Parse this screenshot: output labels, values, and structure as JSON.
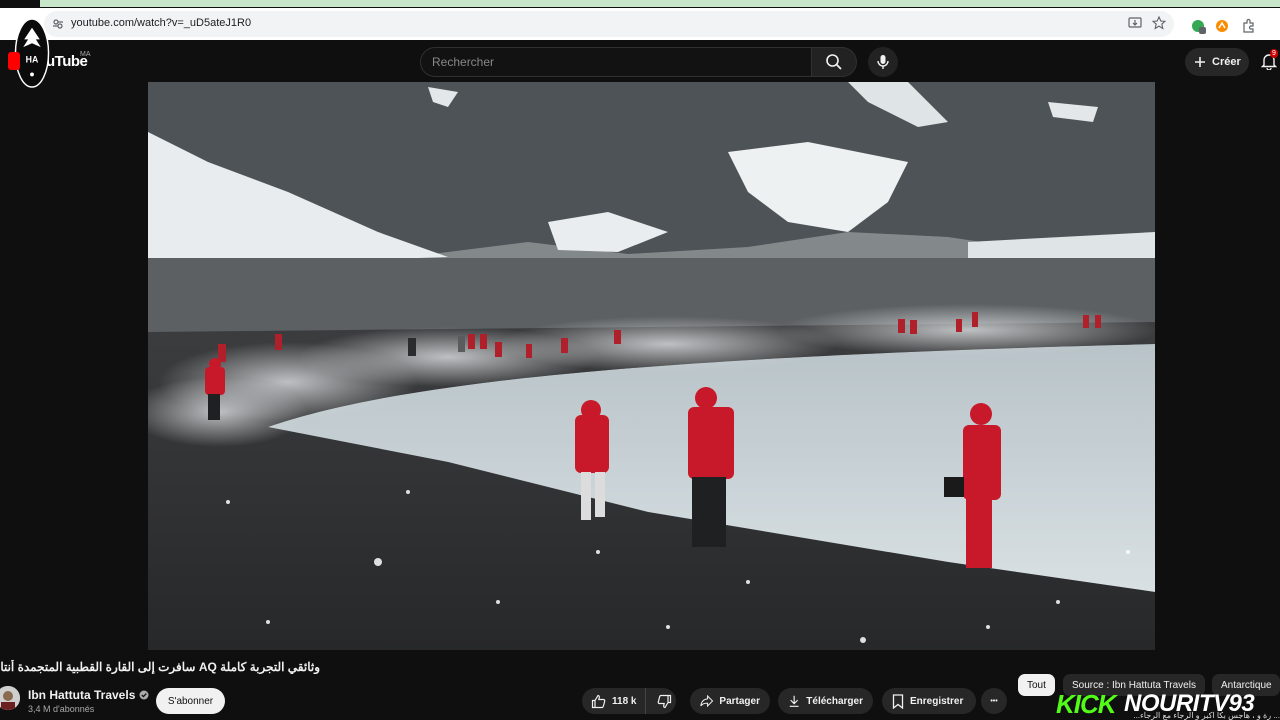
{
  "browser": {
    "url": "youtube.com/watch?v=_uD5ateJ1R0"
  },
  "header": {
    "logo_text": "uTube",
    "country": "MA",
    "search_placeholder": "Rechercher",
    "create_label": "Créer",
    "notification_count": "9"
  },
  "video": {
    "title": "وثائقي التجربة كاملة AQ سافرت إلى القارة القطبية المتجمدة أنتاركتيكا",
    "channel_name": "Ibn Hattuta Travels",
    "subscribers": "3,4 M d'abonnés",
    "subscribe_label": "S'abonner"
  },
  "actions": {
    "likes": "118 k",
    "share": "Partager",
    "download": "Télécharger",
    "save": "Enregistrer",
    "more": "•••"
  },
  "chips": [
    "Tout",
    "Source : Ibn Hattuta Travels",
    "Antarctique"
  ],
  "overlay": {
    "kick_brand": "KICK",
    "kick_channel": "NOURITV93",
    "ticker": "... رة و ، هاجس بكا اكبر و الرجاء مع الرجاء..."
  },
  "colors": {
    "background": "#0f0f0f",
    "kick_green": "#53fc18",
    "jacket_red": "#c8192a"
  }
}
